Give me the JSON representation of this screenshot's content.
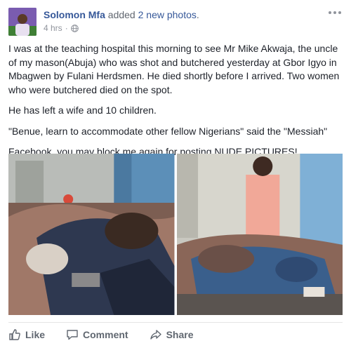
{
  "post": {
    "author": "Solomon Mfa",
    "action_prefix": "added",
    "action_link": "2 new photos",
    "action_suffix": ".",
    "timestamp": "4 hrs",
    "separator": "·",
    "privacy_icon": "globe-icon",
    "options_icon": "ellipsis-icon",
    "paragraphs": [
      "I was at the teaching hospital this morning to see Mr Mike Akwaja, the uncle of my mason(Abuja) who was shot and butchered yesterday at Gbor Igyo in Mbagwen by Fulani Herdsmen. He died shortly before I arrived. Two women who were butchered died on the spot.",
      "He has left a wife and 10 children.",
      "\"Benue, learn to accommodate other fellow Nigerians\" said the \"Messiah\"",
      "Facebook, you may block me again for posting NUDE PICTURES!"
    ],
    "photo_count": 2
  },
  "actions": {
    "like_label": "Like",
    "comment_label": "Comment",
    "share_label": "Share",
    "like_icon": "thumbs-up-icon",
    "comment_icon": "speech-bubble-icon",
    "share_icon": "share-arrow-icon"
  },
  "colors": {
    "link_blue": "#365899",
    "meta_gray": "#90949c",
    "action_gray": "#606770",
    "text": "#1d2129"
  }
}
